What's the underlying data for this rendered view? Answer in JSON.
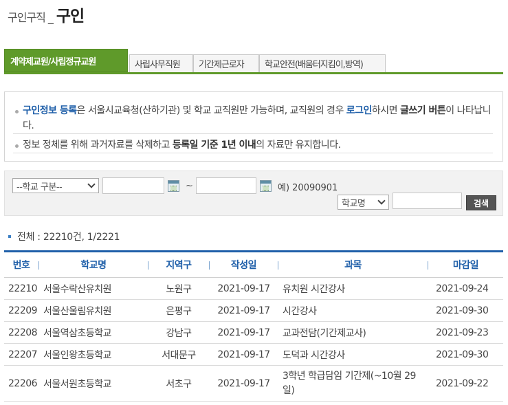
{
  "page_title": {
    "crumb": "구인구직",
    "separator": "_",
    "main": "구인"
  },
  "tabs": [
    {
      "label": "계약제교원/사립정규교원",
      "active": true
    },
    {
      "label": "사립사무직원",
      "active": false
    },
    {
      "label": "기간제근로자",
      "active": false
    },
    {
      "label": "학교안전(배움터지킴이,방역)",
      "active": false
    }
  ],
  "notice": {
    "line1": {
      "a": "구인정보 등록",
      "b": "은 서울시교육청(산하기관) 및 학교 교직원만 가능하며, 교직원의 경우 ",
      "c": "로그인",
      "d": "하시면 ",
      "e": "글쓰기 버튼",
      "f": "이 나타납니다."
    },
    "line2": {
      "a": "정보 정체를 위해 과거자료를 삭제하고 ",
      "b": "등록일 기준 1년 이내",
      "c": "의 자료만 유지합니다."
    }
  },
  "search": {
    "school_type_select": "--학교 구분--",
    "date_from": "",
    "date_to": "",
    "tilde": "~",
    "example": "예) 20090901",
    "field_select": "학교명",
    "keyword": "",
    "button": "검색"
  },
  "total": "전체 : 22210건, 1/2221",
  "table": {
    "headers": [
      "번호",
      "학교명",
      "지역구",
      "작성일",
      "과목",
      "마감일"
    ],
    "rows": [
      {
        "no": "22210",
        "school": "서울수락산유치원",
        "district": "노원구",
        "written": "2021-09-17",
        "subject": "유치원 시간강사",
        "deadline": "2021-09-24"
      },
      {
        "no": "22209",
        "school": "서울산울림유치원",
        "district": "은평구",
        "written": "2021-09-17",
        "subject": "시간강사",
        "deadline": "2021-09-30"
      },
      {
        "no": "22208",
        "school": "서울역삼초등학교",
        "district": "강남구",
        "written": "2021-09-17",
        "subject": "교과전담(기간제교사)",
        "deadline": "2021-09-23"
      },
      {
        "no": "22207",
        "school": "서울인왕초등학교",
        "district": "서대문구",
        "written": "2021-09-17",
        "subject": "도덕과 시간강사",
        "deadline": "2021-09-30"
      },
      {
        "no": "22206",
        "school": "서울서원초등학교",
        "district": "서초구",
        "written": "2021-09-17",
        "subject": "3학년 학급담임 기간제(~10월 29일)",
        "deadline": "2021-09-22"
      }
    ]
  },
  "colors": {
    "tab_active": "#5f9a2a",
    "accent_blue": "#1f5fa9",
    "search_button": "#555555"
  },
  "icons": {
    "calendar": "calendar-icon",
    "dropdown": "chevron-down-icon"
  }
}
